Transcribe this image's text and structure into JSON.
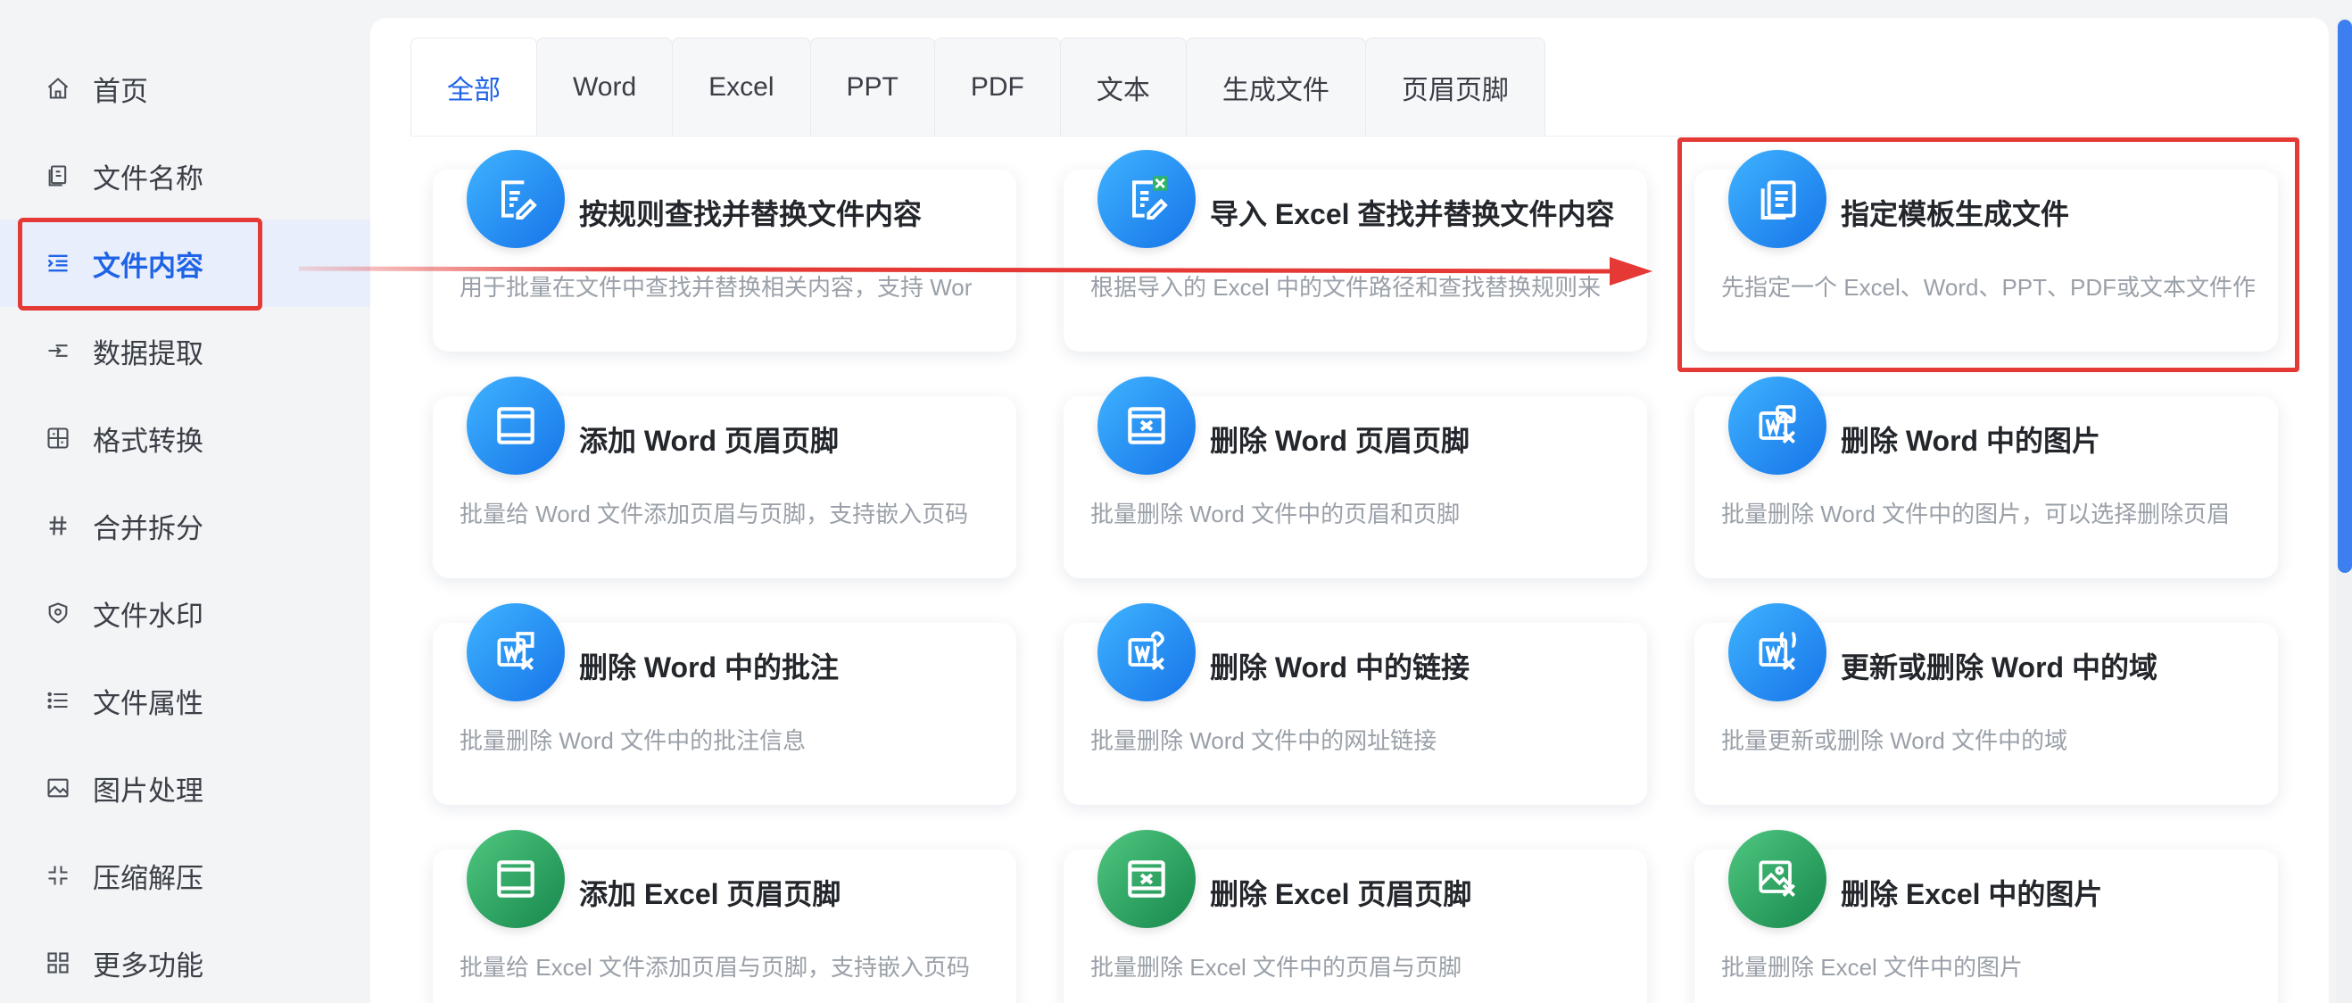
{
  "sidebar": {
    "items": [
      {
        "label": "首页",
        "icon": "home-icon"
      },
      {
        "label": "文件名称",
        "icon": "file-name-icon"
      },
      {
        "label": "文件内容",
        "icon": "list-indent-icon",
        "active": true
      },
      {
        "label": "数据提取",
        "icon": "extract-icon"
      },
      {
        "label": "格式转换",
        "icon": "convert-icon"
      },
      {
        "label": "合并拆分",
        "icon": "hash-icon"
      },
      {
        "label": "文件水印",
        "icon": "watermark-icon"
      },
      {
        "label": "文件属性",
        "icon": "list-icon"
      },
      {
        "label": "图片处理",
        "icon": "image-icon"
      },
      {
        "label": "压缩解压",
        "icon": "compress-icon"
      },
      {
        "label": "更多功能",
        "icon": "grid-icon"
      }
    ]
  },
  "tabs": [
    {
      "label": "全部",
      "active": true
    },
    {
      "label": "Word"
    },
    {
      "label": "Excel"
    },
    {
      "label": "PPT"
    },
    {
      "label": "PDF"
    },
    {
      "label": "文本"
    },
    {
      "label": "生成文件"
    },
    {
      "label": "页眉页脚"
    }
  ],
  "cards": [
    {
      "title": "按规则查找并替换文件内容",
      "desc": "用于批量在文件中查找并替换相关内容，支持 Wor",
      "icon": "edit-doc-icon",
      "color": "blue"
    },
    {
      "title": "导入 Excel 查找并替换文件内容",
      "desc": "根据导入的 Excel 中的文件路径和查找替换规则来",
      "icon": "excel-edit-icon",
      "color": "blue"
    },
    {
      "title": "指定模板生成文件",
      "desc": "先指定一个 Excel、Word、PPT、PDF或文本文件作",
      "icon": "template-copy-icon",
      "color": "blue"
    },
    {
      "title": "添加 Word 页眉页脚",
      "desc": "批量给 Word 文件添加页眉与页脚，支持嵌入页码",
      "icon": "header-footer-icon",
      "color": "blue"
    },
    {
      "title": "删除 Word 页眉页脚",
      "desc": "批量删除 Word 文件中的页眉和页脚",
      "icon": "header-footer-delete-icon",
      "color": "blue"
    },
    {
      "title": "删除 Word 中的图片",
      "desc": "批量删除 Word 文件中的图片，可以选择删除页眉",
      "icon": "word-image-delete-icon",
      "color": "blue"
    },
    {
      "title": "删除 Word 中的批注",
      "desc": "批量删除 Word 文件中的批注信息",
      "icon": "word-comment-delete-icon",
      "color": "blue"
    },
    {
      "title": "删除 Word 中的链接",
      "desc": "批量删除 Word 文件中的网址链接",
      "icon": "word-link-delete-icon",
      "color": "blue"
    },
    {
      "title": "更新或删除 Word 中的域",
      "desc": "批量更新或删除 Word 文件中的域",
      "icon": "word-field-icon",
      "color": "blue"
    },
    {
      "title": "添加 Excel 页眉页脚",
      "desc": "批量给 Excel 文件添加页眉与页脚，支持嵌入页码",
      "icon": "header-footer-icon",
      "color": "green"
    },
    {
      "title": "删除 Excel 页眉页脚",
      "desc": "批量删除 Excel 文件中的页眉与页脚",
      "icon": "header-footer-delete-icon",
      "color": "green"
    },
    {
      "title": "删除 Excel 中的图片",
      "desc": "批量删除 Excel 文件中的图片",
      "icon": "excel-image-delete-icon",
      "color": "green"
    }
  ],
  "colors": {
    "accent": "#1f63e6",
    "highlight": "#e53935",
    "card_blue": "#1674e8",
    "card_green": "#17884c"
  }
}
